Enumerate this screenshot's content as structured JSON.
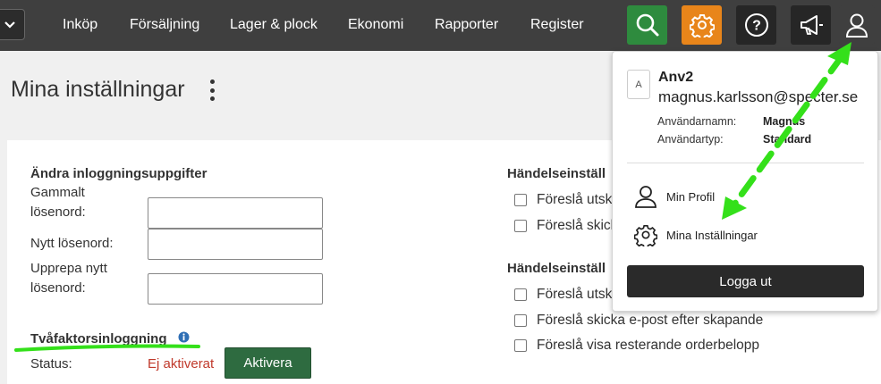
{
  "colors": {
    "topbar": "#3f3f3f",
    "search_button": "#2e8b3e",
    "settings_button": "#e8851a",
    "activate_button": "#2e6b40",
    "status_inactive": "#c0392b",
    "annotation": "#34e01a"
  },
  "nav": {
    "items": [
      "Inköp",
      "Försäljning",
      "Lager & plock",
      "Ekonomi",
      "Rapporter",
      "Register"
    ],
    "icons": [
      "search-icon",
      "gear-icon",
      "help-icon",
      "megaphone-icon",
      "user-icon"
    ]
  },
  "page": {
    "title": "Mina inställningar"
  },
  "login": {
    "title": "Ändra inloggningsuppgifter",
    "old_password_line1": "Gammalt",
    "old_password_line2": "lösenord:",
    "new_password": "Nytt lösenord:",
    "repeat_line1": "Upprepa nytt",
    "repeat_line2": "lösenord:"
  },
  "two_factor": {
    "title": "Tvåfaktorsinloggning",
    "status_label": "Status:",
    "status_value": "Ej aktiverat",
    "activate_label": "Aktivera"
  },
  "events1": {
    "title": "Händelseinställ",
    "options": [
      "Föreslå utsk",
      "Föreslå skick"
    ]
  },
  "events2": {
    "title": "Händelseinställ",
    "options": [
      "Föreslå utsk",
      "Föreslå skicka e-post efter skapande",
      "Föreslå visa resterande orderbelopp"
    ]
  },
  "dropdown": {
    "avatar_letter": "A",
    "name": "Anv2",
    "email": "magnus.karlsson@specter.se",
    "username_label": "Användarnamn:",
    "username_value": "Magnus",
    "usertype_label": "Användartyp:",
    "usertype_value": "Standard",
    "profile_label": "Min Profil",
    "settings_label": "Mina Inställningar",
    "logout_label": "Logga ut"
  }
}
